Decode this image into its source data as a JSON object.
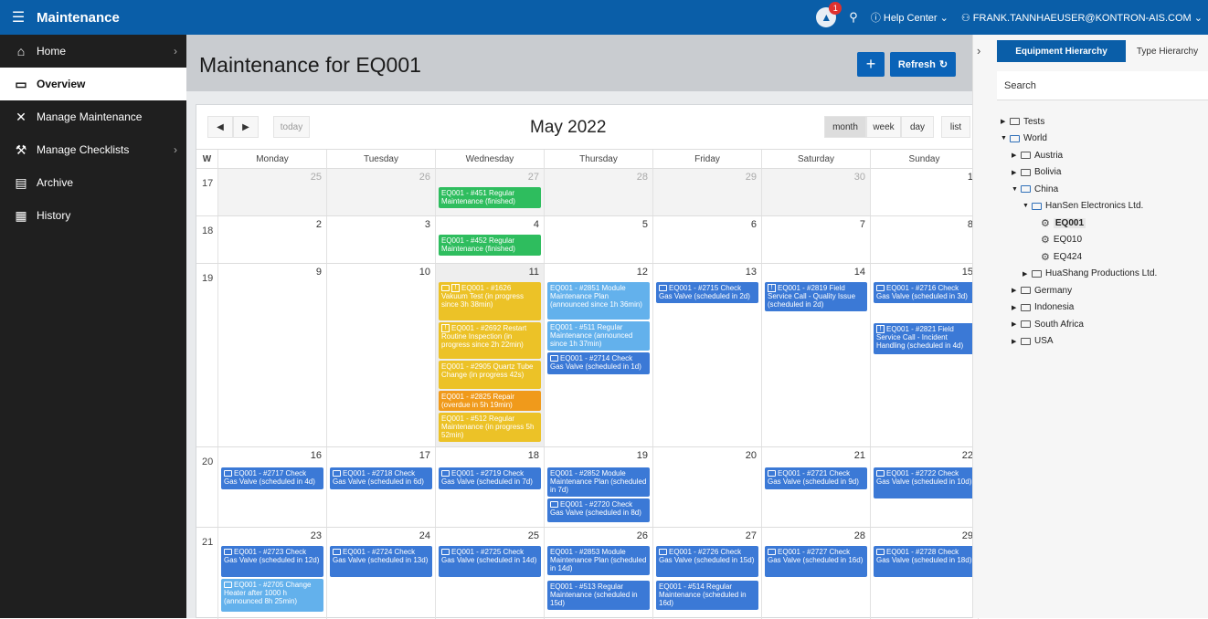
{
  "topbar": {
    "app_title": "Maintenance",
    "notifications_count": "1",
    "help_label": "Help Center",
    "user_label": "FRANK.TANNHAEUSER@KONTRON-AIS.COM"
  },
  "sidebar": {
    "items": [
      {
        "label": "Home",
        "icon": "home-icon",
        "has_chevron": true
      },
      {
        "label": "Overview",
        "icon": "overview-icon",
        "active": true
      },
      {
        "label": "Manage Maintenance",
        "icon": "tools-icon"
      },
      {
        "label": "Manage Checklists",
        "icon": "wrench-icon",
        "has_chevron": true
      },
      {
        "label": "Archive",
        "icon": "archive-icon"
      },
      {
        "label": "History",
        "icon": "calendar-icon"
      }
    ]
  },
  "page": {
    "title": "Maintenance for EQ001",
    "add_label": "+",
    "refresh_label": "Refresh"
  },
  "calendar": {
    "title": "May 2022",
    "today_label": "today",
    "views": [
      "month",
      "week",
      "day",
      "list"
    ],
    "active_view": "month",
    "week_header": "W",
    "day_headers": [
      "Monday",
      "Tuesday",
      "Wednesday",
      "Thursday",
      "Friday",
      "Saturday",
      "Sunday"
    ],
    "weeks": [
      {
        "num": "17",
        "days": [
          "25",
          "26",
          "27",
          "28",
          "29",
          "30",
          "1"
        ]
      },
      {
        "num": "18",
        "days": [
          "2",
          "3",
          "4",
          "5",
          "6",
          "7",
          "8"
        ]
      },
      {
        "num": "19",
        "days": [
          "9",
          "10",
          "11",
          "12",
          "13",
          "14",
          "15"
        ]
      },
      {
        "num": "20",
        "days": [
          "16",
          "17",
          "18",
          "19",
          "20",
          "21",
          "22"
        ]
      },
      {
        "num": "21",
        "days": [
          "23",
          "24",
          "25",
          "26",
          "27",
          "28",
          "29"
        ]
      }
    ],
    "events": {
      "e451": "EQ001 - #451 Regular Maintenance (finished)",
      "e452": "EQ001 - #452 Regular Maintenance (finished)",
      "e1626": "EQ001 - #1626 Vakuum Test (in progress since 3h 38min)",
      "e2692": "EQ001 - #2692 Restart Routine Inspection (in progress since 2h 22min)",
      "e2905": "EQ001 - #2905 Quartz Tube Change (in progress 42s)",
      "e2825": "EQ001 - #2825 Repair (overdue in 5h 19min)",
      "e512": "EQ001 - #512 Regular Maintenance (in progress 5h 52min)",
      "e2851": "EQ001 - #2851 Module Maintenance Plan (announced since 1h 36min)",
      "e511": "EQ001 - #511 Regular Maintenance (announced since 1h 37min)",
      "e2714": "EQ001 - #2714 Check Gas Valve (scheduled in 1d)",
      "e2715": "EQ001 - #2715 Check Gas Valve (scheduled in 2d)",
      "e2819": "EQ001 - #2819 Field Service Call - Quality Issue (scheduled in 2d)",
      "e2716": "EQ001 - #2716 Check Gas Valve (scheduled in 3d)",
      "e2821": "EQ001 - #2821 Field Service Call - Incident Handling (scheduled in 4d)",
      "e2717": "EQ001 - #2717 Check Gas Valve (scheduled in 4d)",
      "e2718": "EQ001 - #2718 Check Gas Valve (scheduled in 6d)",
      "e2719": "EQ001 - #2719 Check Gas Valve (scheduled in 7d)",
      "e2852": "EQ001 - #2852 Module Maintenance Plan (scheduled in 7d)",
      "e2720": "EQ001 - #2720 Check Gas Valve (scheduled in 8d)",
      "e2721": "EQ001 - #2721 Check Gas Valve (scheduled in 9d)",
      "e2722": "EQ001 - #2722 Check Gas Valve (scheduled in 10d)",
      "e2723": "EQ001 - #2723 Check Gas Valve (scheduled in 12d)",
      "e2705": "EQ001 - #2705 Change Heater after 1000 h (announced 8h 25min)",
      "e2724": "EQ001 - #2724 Check Gas Valve (scheduled in 13d)",
      "e2725": "EQ001 - #2725 Check Gas Valve (scheduled in 14d)",
      "e2853": "EQ001 - #2853 Module Maintenance Plan (scheduled in 14d)",
      "e513": "EQ001 - #513 Regular Maintenance (scheduled in 15d)",
      "e2726": "EQ001 - #2726 Check Gas Valve (scheduled in 15d)",
      "e514": "EQ001 - #514 Regular Maintenance (scheduled in 16d)",
      "e2727": "EQ001 - #2727 Check Gas Valve (scheduled in 16d)",
      "e2728": "EQ001 - #2728 Check Gas Valve (scheduled in 18d)"
    }
  },
  "right_panel": {
    "tabs": [
      "Equipment Hierarchy",
      "Type Hierarchy"
    ],
    "search_placeholder": "Search",
    "tree": [
      "Tests",
      "World",
      "Austria",
      "Bolivia",
      "China",
      "HanSen Electronics Ltd.",
      "EQ001",
      "EQ010",
      "EQ424",
      "HuaShang Productions Ltd.",
      "Germany",
      "Indonesia",
      "South Africa",
      "USA"
    ]
  },
  "colors": {
    "topbar": "#0a5ea8",
    "finished": "#2ebd5e",
    "scheduled": "#3b79d6",
    "announced": "#63b1ec",
    "in_progress": "#ecc227",
    "overdue": "#f09a1b"
  }
}
